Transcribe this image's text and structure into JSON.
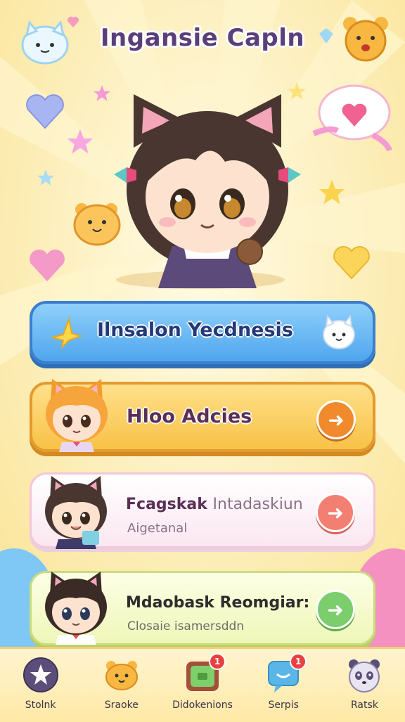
{
  "app": {
    "title": "Ingansie Capln"
  },
  "menu": {
    "items": [
      {
        "label": "Ilnsalon Yecdnesis"
      },
      {
        "label": "Hloo Adcies"
      },
      {
        "label_main": "Fcagskak",
        "label_rest": "Intadaskiun",
        "sub": "Aigetanal"
      },
      {
        "label": "Mdaobask Reomgiar:",
        "sub": "Closaie isamersddn"
      }
    ]
  },
  "nav": {
    "items": [
      {
        "label": "Stolnk",
        "icon": "star-icon"
      },
      {
        "label": "Sraoke",
        "icon": "bear-icon"
      },
      {
        "label": "Didokenions",
        "icon": "chest-icon",
        "badge": "1"
      },
      {
        "label": "Serpis",
        "icon": "chat-bubble-icon",
        "badge": "1"
      },
      {
        "label": "Ratsk",
        "icon": "panda-icon"
      }
    ]
  },
  "colors": {
    "background": "#fdf3c4",
    "primary_card": "#4fa6ee",
    "accent_orange": "#f7c247",
    "title": "#5b3f7a"
  }
}
